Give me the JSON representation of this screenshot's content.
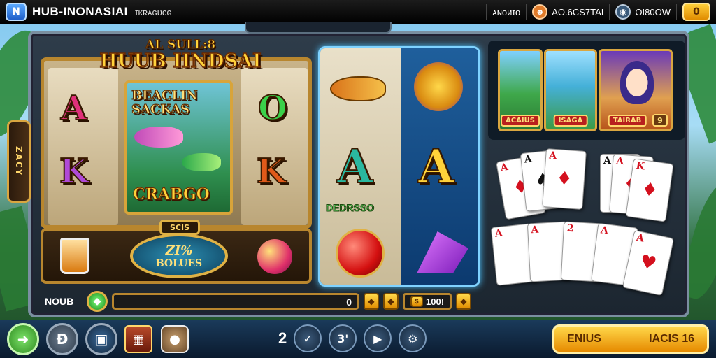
{
  "topbar": {
    "logo_letter": "N",
    "title": "HUB-INONASIAI",
    "subtitle": "ɪᴋʀᴀɢᴜᴄɢ",
    "chip1": "ᴀɴᴏᴎɪᴏ",
    "chip2": "AO.6CS7TAI",
    "chip3": "OI80OW",
    "coin": "0"
  },
  "side_tab": "ZACY",
  "game": {
    "title_top": "AL SULL:8",
    "title_main": "HUUB IINDSAI",
    "featured_title": "BEACLIN SACKAS",
    "featured_bottom": "CRABGO",
    "left_letters": [
      "A",
      "K",
      "O",
      "K"
    ]
  },
  "bonus": {
    "tag": "SCIS",
    "percent": "ZI%",
    "label": "BOLUES"
  },
  "center": {
    "letter_left": "A",
    "letter_right": "A",
    "label": "DEDRSSO"
  },
  "thumbnails": [
    {
      "label": "ACAIUS"
    },
    {
      "label": "ISAGA"
    },
    {
      "label": "TAIRAB",
      "badge": "9"
    }
  ],
  "cards_top": [
    {
      "rank": "A",
      "suit": "♦",
      "color": "red"
    },
    {
      "rank": "A",
      "suit": "♠",
      "color": "blk"
    },
    {
      "rank": "A",
      "suit": "♦",
      "color": "red"
    },
    {
      "rank": "A",
      "suit": "♠",
      "color": "blk"
    },
    {
      "rank": "A",
      "suit": "♦",
      "color": "red"
    },
    {
      "rank": "K",
      "suit": "♦",
      "color": "red"
    }
  ],
  "cards_bottom": [
    {
      "rank": "A",
      "suit": "♦",
      "color": "red"
    },
    {
      "rank": "A",
      "suit": "♦",
      "color": "red"
    },
    {
      "rank": "2",
      "suit": "♦",
      "color": "red"
    },
    {
      "rank": "A",
      "suit": "♦",
      "color": "red"
    },
    {
      "rank": "A",
      "suit": "♥",
      "color": "red"
    }
  ],
  "progress": {
    "label": "NOUB",
    "value": "0",
    "amount": "100!",
    "fill_fraction": 0
  },
  "bottom": {
    "ctrl_num_1": "2",
    "ctrl_num_2": "3'",
    "cta_left": "ENIUS",
    "cta_right": "IACIS 16"
  },
  "colors": {
    "accent_gold": "#e0b245",
    "frame_blue": "#7fd2ff",
    "cta_orange": "#e68a00"
  }
}
